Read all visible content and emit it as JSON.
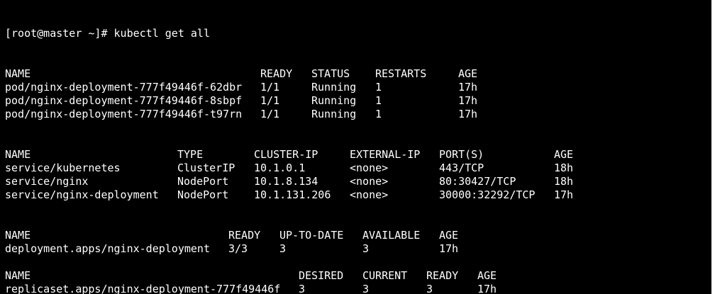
{
  "terminal": {
    "prompt": "[root@master ~]# ",
    "command": "kubectl get all",
    "pods": {
      "headers": [
        "NAME",
        "READY",
        "STATUS",
        "RESTARTS",
        "AGE"
      ],
      "rows": [
        [
          "pod/nginx-deployment-777f49446f-62dbr",
          "1/1",
          "Running",
          "1",
          "17h"
        ],
        [
          "pod/nginx-deployment-777f49446f-8sbpf",
          "1/1",
          "Running",
          "1",
          "17h"
        ],
        [
          "pod/nginx-deployment-777f49446f-t97rn",
          "1/1",
          "Running",
          "1",
          "17h"
        ]
      ]
    },
    "services": {
      "headers": [
        "NAME",
        "TYPE",
        "CLUSTER-IP",
        "EXTERNAL-IP",
        "PORT(S)",
        "AGE"
      ],
      "rows": [
        [
          "service/kubernetes",
          "ClusterIP",
          "10.1.0.1",
          "<none>",
          "443/TCP",
          "18h"
        ],
        [
          "service/nginx",
          "NodePort",
          "10.1.8.134",
          "<none>",
          "80:30427/TCP",
          "18h"
        ],
        [
          "service/nginx-deployment",
          "NodePort",
          "10.1.131.206",
          "<none>",
          "30000:32292/TCP",
          "17h"
        ]
      ]
    },
    "deployments": {
      "headers": [
        "NAME",
        "READY",
        "UP-TO-DATE",
        "AVAILABLE",
        "AGE"
      ],
      "rows": [
        [
          "deployment.apps/nginx-deployment",
          "3/3",
          "3",
          "3",
          "17h"
        ]
      ]
    },
    "replicasets": {
      "headers": [
        "NAME",
        "DESIRED",
        "CURRENT",
        "READY",
        "AGE"
      ],
      "rows": [
        [
          "replicaset.apps/nginx-deployment-777f49446f",
          "3",
          "3",
          "3",
          "17h"
        ]
      ]
    },
    "colors": {
      "background": "#000000",
      "foreground": "#ffffff"
    }
  }
}
